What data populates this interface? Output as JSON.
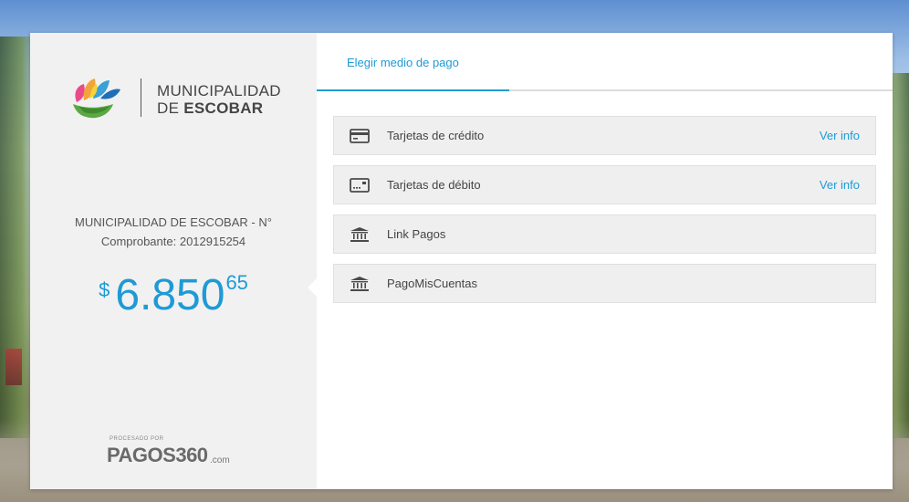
{
  "merchant": {
    "logo_line1": "MUNICIPALIDAD",
    "logo_line2_prefix": "DE",
    "logo_line2_bold": "ESCOBAR"
  },
  "receipt": {
    "line1": "MUNICIPALIDAD DE ESCOBAR - N°",
    "line2": "Comprobante: 2012915254"
  },
  "amount": {
    "currency": "$",
    "integer": "6.850",
    "decimals": "65"
  },
  "processor": {
    "caption": "PROCESADO POR",
    "brand": "PAGOS360",
    "domain": ".com"
  },
  "tabs": [
    {
      "label": "Elegir medio de pago",
      "active": true
    }
  ],
  "methods": [
    {
      "label": "Tarjetas de crédito",
      "icon": "credit-card-icon",
      "info": "Ver info"
    },
    {
      "label": "Tarjetas de débito",
      "icon": "debit-card-icon",
      "info": "Ver info"
    },
    {
      "label": "Link Pagos",
      "icon": "bank-icon"
    },
    {
      "label": "PagoMisCuentas",
      "icon": "bank-icon"
    }
  ],
  "colors": {
    "accent": "#1e9ad6",
    "panel": "#f1f1f1",
    "method_bg": "#efefef"
  }
}
